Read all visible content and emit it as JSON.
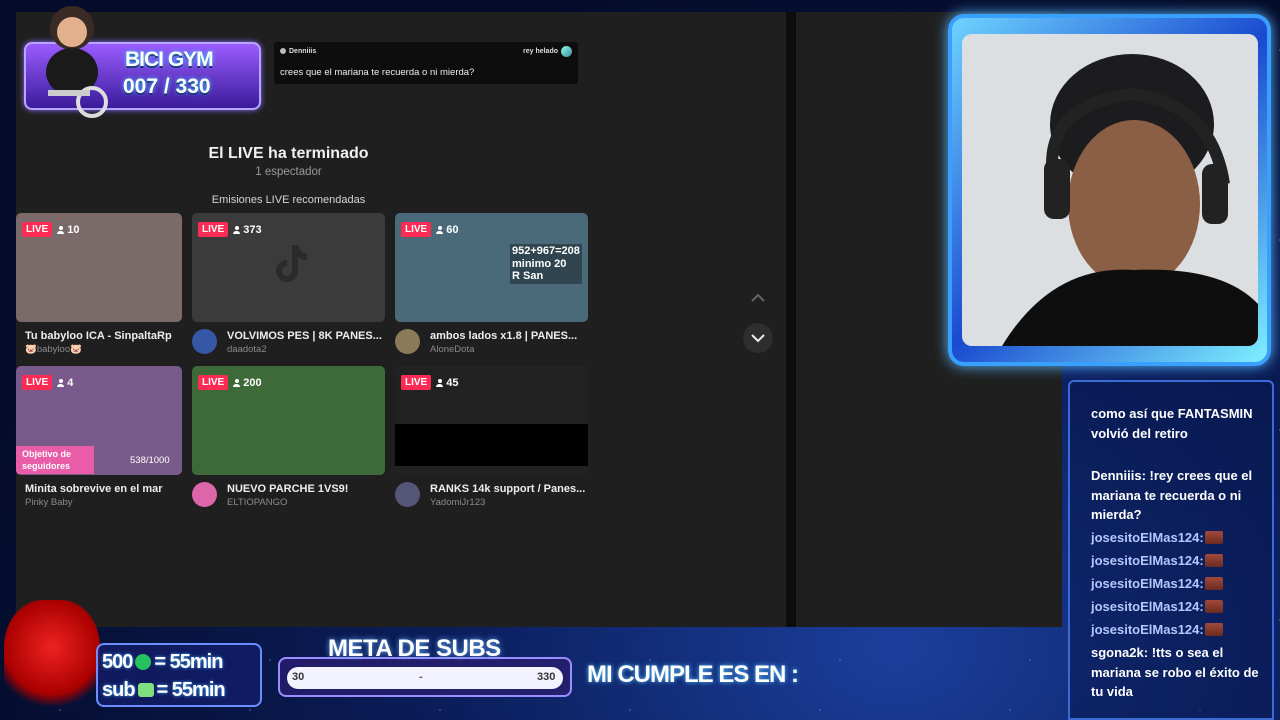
{
  "chat_popup": {
    "username": "Denniiis",
    "recipient": "rey helado",
    "message": "crees que el mariana te recuerda o ni mierda?"
  },
  "live_ended": {
    "title": "El LIVE ha terminado",
    "viewers": "1 espectador",
    "recommended_label": "Emisiones LIVE recomendadas"
  },
  "live_label": "LIVE",
  "streams": [
    {
      "viewers": "10",
      "title": "Tu babyloo ICA - SinpaltaRp",
      "author": "🐷babyloo🐷",
      "thumb_color": "#7a6a6a",
      "avatar_color": "#c49"
    },
    {
      "viewers": "373",
      "title": "VOLVIMOS PES | 8K PANES...",
      "author": "daadota2",
      "thumb_color": "#3b3b3b",
      "avatar_color": "#3656a6"
    },
    {
      "viewers": "60",
      "title": "ambos lados x1.8 | PANES...",
      "author": "AloneDota",
      "thumb_color": "#4a6a7a",
      "avatar_color": "#8a7a5a"
    },
    {
      "viewers": "4",
      "title": "Minita sobrevive en el mar",
      "author": "Pinky Baby",
      "thumb_color": "#7a5a8a",
      "avatar_color": "#b58"
    },
    {
      "viewers": "200",
      "title": "NUEVO PARCHE 1VS9!",
      "author": "ELTIOPANGO",
      "thumb_color": "#3e6a3a",
      "avatar_color": "#d6a"
    },
    {
      "viewers": "45",
      "title": "RANKS 14k support / Panes...",
      "author": "YadomiJr123",
      "thumb_color": "#222222",
      "avatar_color": "#557"
    }
  ],
  "thumb_overlays": {
    "stream3": [
      "952+967=208",
      "minimo 20",
      "R San"
    ],
    "stream4_goal": "Objetivo de seguidores",
    "stream4_count": "538/1000"
  },
  "bici_gym": {
    "title": "BICI GYM",
    "count": "007 / 330"
  },
  "chat": [
    {
      "user": "",
      "text": "como así que FANTASMIN volvió del retiro"
    },
    {
      "user": "Denniiis:",
      "text": " !rey crees que el mariana te recuerda o ni mierda?"
    },
    {
      "user": "josesitoElMas124:",
      "text": ""
    },
    {
      "user": "josesitoElMas124:",
      "text": ""
    },
    {
      "user": "josesitoElMas124:",
      "text": ""
    },
    {
      "user": "josesitoElMas124:",
      "text": ""
    },
    {
      "user": "josesitoElMas124:",
      "text": ""
    },
    {
      "user": "sgona2k:",
      "text": " !tts o sea el mariana se robo el éxito de tu vida"
    }
  ],
  "points": {
    "line1_amount": "500",
    "line1_rhs": "= 55min",
    "line2_label": "sub",
    "line2_rhs": "= 55min"
  },
  "meta_subs": {
    "title": "META DE SUBS",
    "start": "30",
    "mid": "-",
    "end": "330"
  },
  "birthday": "MI CUMPLE ES EN :",
  "colors": {
    "live_badge": "#fe2c55",
    "panel_bg": "#1f1f1f",
    "cam_frame": "#3aa0ff"
  }
}
